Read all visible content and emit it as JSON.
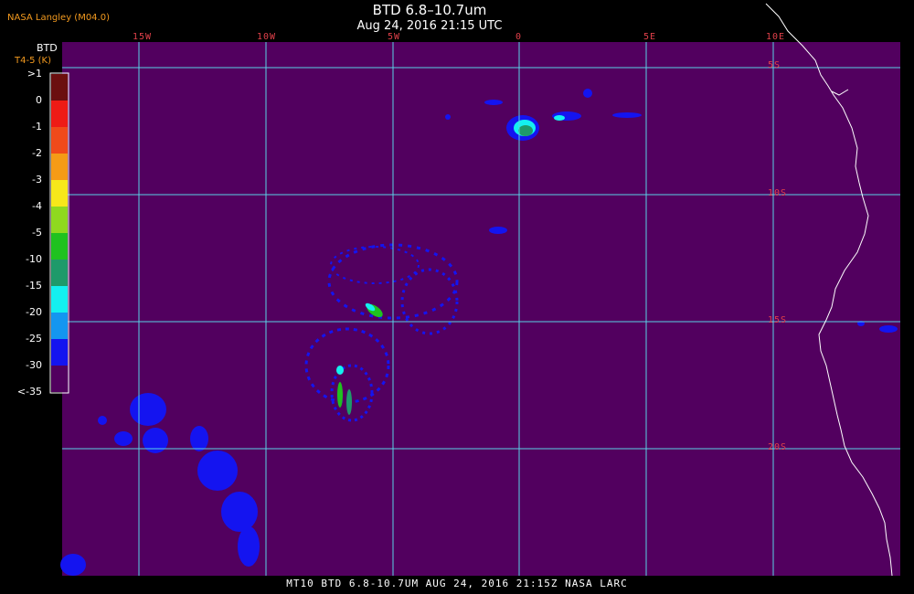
{
  "header": {
    "credit": "NASA Langley (M04.0)",
    "title": "BTD 6.8–10.7um",
    "subtitle": "Aug 24, 2016 21:15 UTC"
  },
  "legend": {
    "title_line1": "BTD",
    "title_line2": "T4-5 (K)",
    "entries": [
      {
        "label": ">1",
        "color": "#6b0f0f"
      },
      {
        "label": "0",
        "color": "#ee1b16"
      },
      {
        "label": "-1",
        "color": "#f04a1a"
      },
      {
        "label": "-2",
        "color": "#f59b16"
      },
      {
        "label": "-3",
        "color": "#f7e81a"
      },
      {
        "label": "-4",
        "color": "#8fd91f"
      },
      {
        "label": "-5",
        "color": "#1fc21f"
      },
      {
        "label": "-10",
        "color": "#1e9a6a"
      },
      {
        "label": "-15",
        "color": "#14f0f0"
      },
      {
        "label": "-20",
        "color": "#1496f0"
      },
      {
        "label": "-25",
        "color": "#1414f0"
      },
      {
        "label": "-30",
        "color": "#52005f"
      },
      {
        "label": "<-35",
        "color": "#52005f"
      }
    ]
  },
  "grid": {
    "lon_labels": [
      "15W",
      "10W",
      "5W",
      "0",
      "5E",
      "10E"
    ],
    "lat_labels": [
      "5S",
      "10S",
      "15S",
      "20S"
    ]
  },
  "colors": {
    "background": "#52005f",
    "grid": "#5ad2e6",
    "label": "#e0404a",
    "coast": "#ffffff"
  },
  "footer": {
    "text": "MT10  BTD 6.8-10.7UM  AUG 24, 2016 21:15Z  NASA LARC"
  }
}
